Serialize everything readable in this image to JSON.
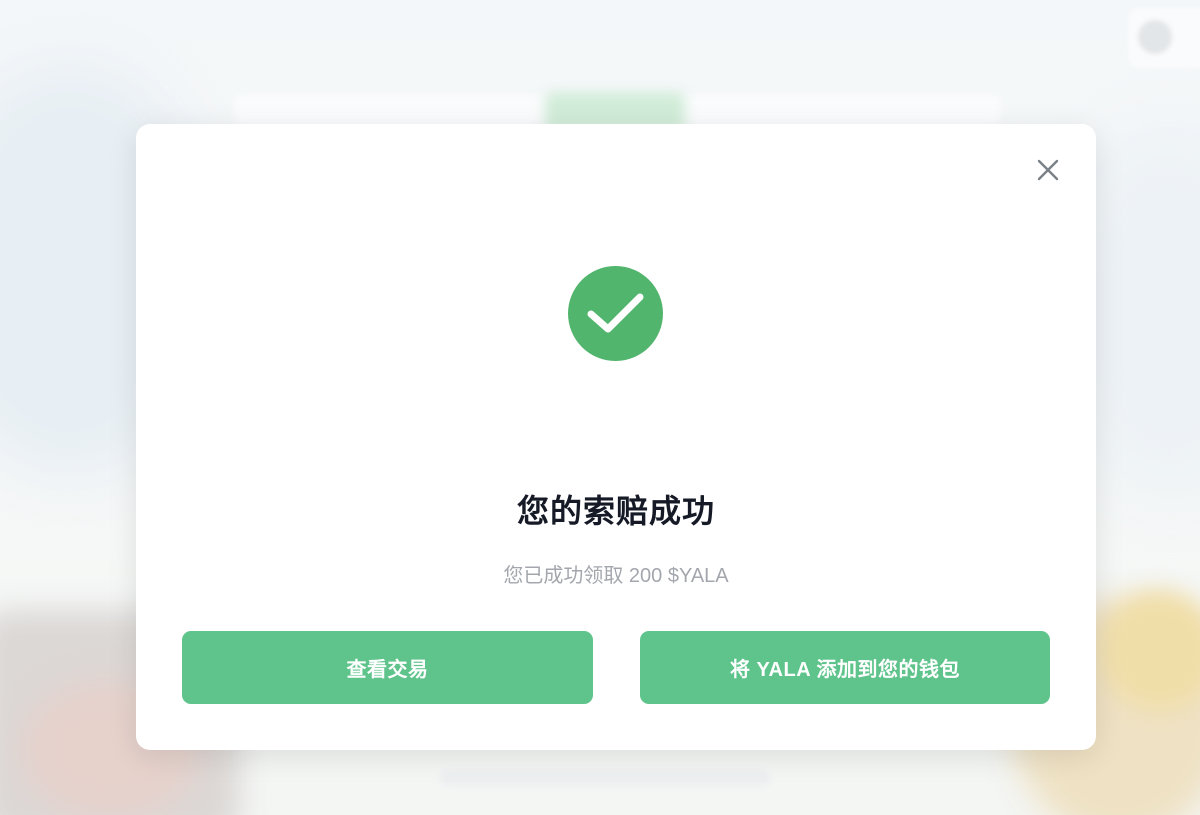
{
  "modal": {
    "title": "您的索赔成功",
    "subtitle": "您已成功领取 200 $YALA",
    "close_icon": "close-icon",
    "status_icon": "check-circle-icon",
    "buttons": {
      "view_transaction": "查看交易",
      "add_to_wallet": "将 YALA 添加到您的钱包"
    }
  },
  "colors": {
    "accent_green": "#5fc48c",
    "check_green": "#52b56d",
    "title_text": "#151a26",
    "subtitle_text": "#a3a7ad"
  }
}
